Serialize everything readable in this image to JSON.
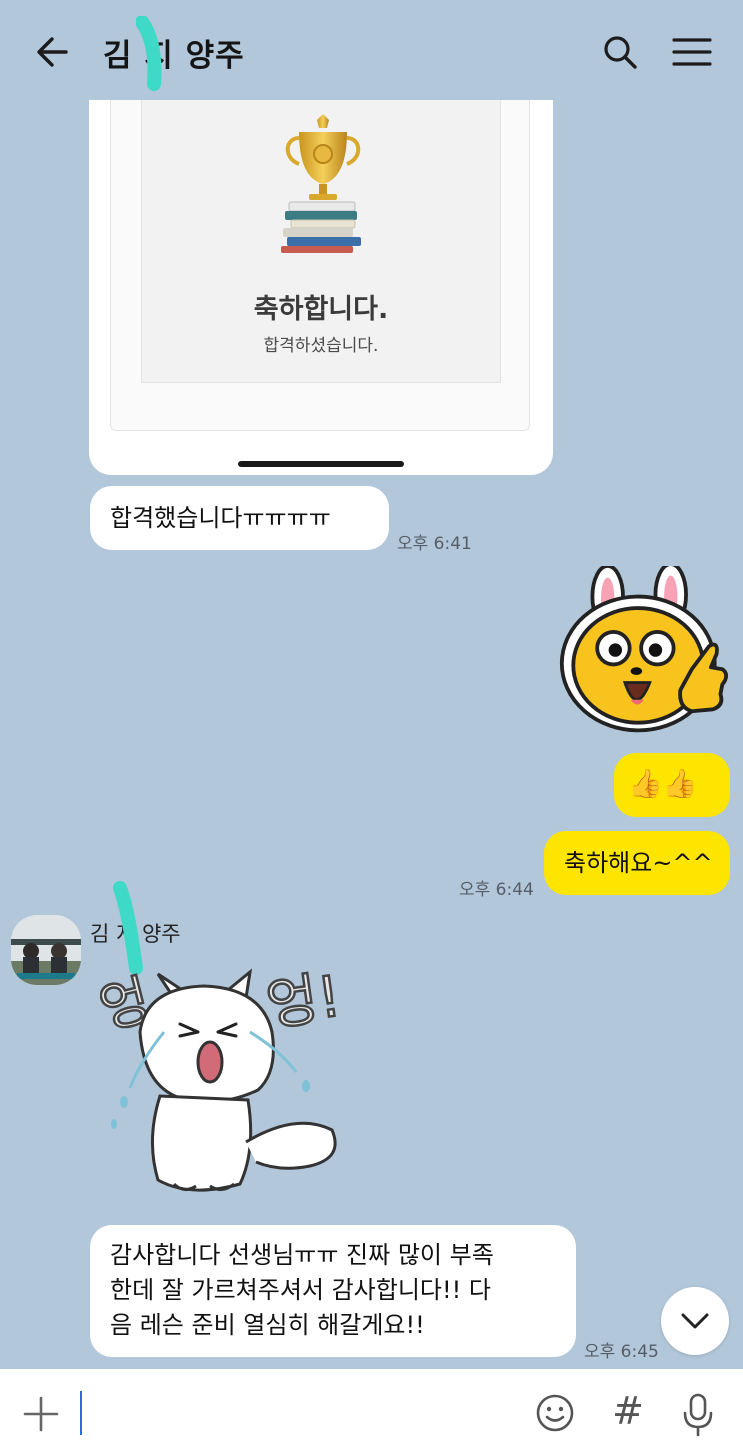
{
  "header": {
    "title": "김 지 양주",
    "back_icon": "back-arrow-icon",
    "search_icon": "search-icon",
    "menu_icon": "menu-icon"
  },
  "card": {
    "title": "축하합니다.",
    "subtitle": "합격하셨습니다."
  },
  "messages": [
    {
      "side": "in",
      "text": "합격했습니다ㅠㅠㅠㅠ",
      "time": "오후 6:41"
    },
    {
      "side": "out",
      "sticker": "rabbit-thumbs-up-sticker"
    },
    {
      "side": "out",
      "text": "👍👍"
    },
    {
      "side": "out",
      "text": "축하해요~^^",
      "time": "오후 6:44"
    },
    {
      "side": "in",
      "sender": "김 지 양주",
      "sticker": "crying-cat-sticker",
      "sticker_text": "엉엉!"
    },
    {
      "side": "in",
      "lines": [
        "감사합니다 선생님ㅠㅠ 진짜 많이 부족",
        "한데 잘 가르쳐주셔서 감사합니다!! 다",
        "음 레슨 준비 열심히 해갈게요!!"
      ],
      "time": "오후 6:45"
    }
  ],
  "input": {
    "placeholder": "",
    "plus_icon": "plus-icon",
    "emoji_icon": "emoji-icon",
    "hash_label": "#",
    "mic_icon": "microphone-icon"
  },
  "colors": {
    "background": "#b2c7da",
    "outgoing_bubble": "#fee500",
    "incoming_bubble": "#ffffff",
    "redaction_mark": "#3fd9c7"
  }
}
